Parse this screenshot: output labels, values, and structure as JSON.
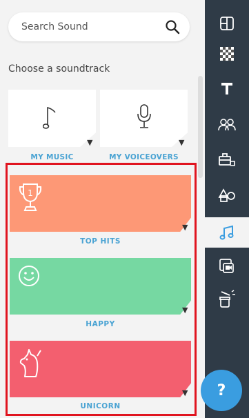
{
  "search": {
    "placeholder": "Search Sound"
  },
  "section_heading": "Choose a soundtrack",
  "tiles": [
    {
      "label": "MY MUSIC",
      "icon": "music-note-icon"
    },
    {
      "label": "MY VOICEOVERS",
      "icon": "microphone-icon"
    }
  ],
  "categories": [
    {
      "label": "TOP HITS",
      "icon": "trophy-icon",
      "color": "#fd9876"
    },
    {
      "label": "HAPPY",
      "icon": "smiley-icon",
      "color": "#76d8a2"
    },
    {
      "label": "UNICORN",
      "icon": "unicorn-icon",
      "color": "#f35f6f"
    }
  ],
  "caret": "▼",
  "toolbar": {
    "items": [
      "layout-icon",
      "background-icon",
      "text-icon",
      "characters-icon",
      "props-icon",
      "shapes-icon",
      "music-icon",
      "media-icon",
      "effects-icon"
    ],
    "active": "music-icon"
  },
  "help": {
    "label": "?"
  },
  "colors": {
    "accent": "#4aa3d3",
    "toolbar_bg": "#2f3b47",
    "selection": "#e0141f",
    "help_bg": "#3a9de0"
  }
}
